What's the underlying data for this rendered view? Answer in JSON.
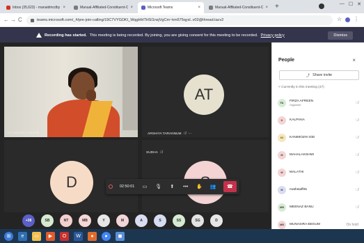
{
  "browser": {
    "tabs": [
      {
        "title": "Inbox (35,623) - rnanaidmcdby",
        "active": false,
        "color": "#d93025"
      },
      {
        "title": "Manual-Affiliated-Constituent-C",
        "active": false,
        "color": "#7a7a7a"
      },
      {
        "title": "Microsoft Teams",
        "active": true,
        "color": "#5b5fc7"
      },
      {
        "title": "Manual-Affiliated-Constituent-C",
        "active": false,
        "color": "#7a7a7a"
      }
    ],
    "new_tab": "+",
    "url": "teams.microsoft.com/_#/pre-join-calling/19C7VYGDKI_WqgHHTHSl1nsjVgCm~km575qysl..v03@thread.tacv2",
    "star": "☆"
  },
  "banner": {
    "bold_text": "Recording has started.",
    "text": "This meeting is being recorded. By joining, you are giving consent for this meeting to be recorded.",
    "link": "Privacy policy",
    "dismiss": "Dismiss"
  },
  "stage": {
    "tiles": [
      {
        "kind": "video",
        "name": "Sri Kalaiselvi Ganesh"
      },
      {
        "kind": "avatar",
        "initials": "AT",
        "name": "ARSHIYA TARANNUM",
        "color": "#e6e1cf"
      },
      {
        "kind": "avatar",
        "initials": "D",
        "name": "",
        "color": "#f6dcc6"
      },
      {
        "kind": "avatar",
        "initials": "S",
        "name": "SUDHA",
        "color": "#f3d3d3"
      }
    ],
    "controls": {
      "timer": "02:50:01",
      "more": "•••"
    },
    "strip": [
      {
        "label": "+38",
        "color": "#5b5fc7",
        "text_color": "#ffffff"
      },
      {
        "label": "SB",
        "color": "#d6ead2"
      },
      {
        "label": "NT",
        "color": "#f4cfcf"
      },
      {
        "label": "MB",
        "color": "#f5d7d7"
      },
      {
        "label": "Y",
        "color": "#e6e6e6"
      },
      {
        "label": "M",
        "color": "#f2d5d8"
      },
      {
        "label": "A",
        "color": "#dadcf2"
      },
      {
        "label": "S",
        "color": "#d6dcf2"
      },
      {
        "label": "SS",
        "color": "#d6ead2"
      },
      {
        "label": "SG",
        "color": "#e3e3e3"
      },
      {
        "label": "D",
        "color": "#e7e7e7"
      }
    ]
  },
  "panel": {
    "title": "People",
    "close": "×",
    "share_invite": "Share invite",
    "section": "Currently in this meeting (47)",
    "people": [
      {
        "initials": "FA",
        "name": "FIRZA AFREEN",
        "role": "Organizer",
        "status": "",
        "color": "#d7ebd4"
      },
      {
        "initials": "K",
        "name": "KALPANA",
        "role": "",
        "status": "",
        "color": "#f5d4d4"
      },
      {
        "initials": "KI",
        "name": "KANIMOZHI IDD",
        "role": "",
        "status": "",
        "color": "#f6e6b8"
      },
      {
        "initials": "M",
        "name": "MAHALAKSHMI",
        "role": "",
        "status": "",
        "color": "#f5d4d4"
      },
      {
        "initials": "M",
        "name": "MALATHI",
        "role": "",
        "status": "",
        "color": "#f5d4d4"
      },
      {
        "initials": "M",
        "name": "mathstaff05",
        "role": "",
        "status": "",
        "color": "#dadcf2"
      },
      {
        "initials": "MB",
        "name": "MEENAZ BANU",
        "role": "",
        "status": "",
        "color": "#d7ebd4"
      },
      {
        "initials": "MB",
        "name": "MUNASIRA BEGUM",
        "role": "",
        "status": "On hold",
        "color": "#f5d4d4"
      }
    ]
  }
}
